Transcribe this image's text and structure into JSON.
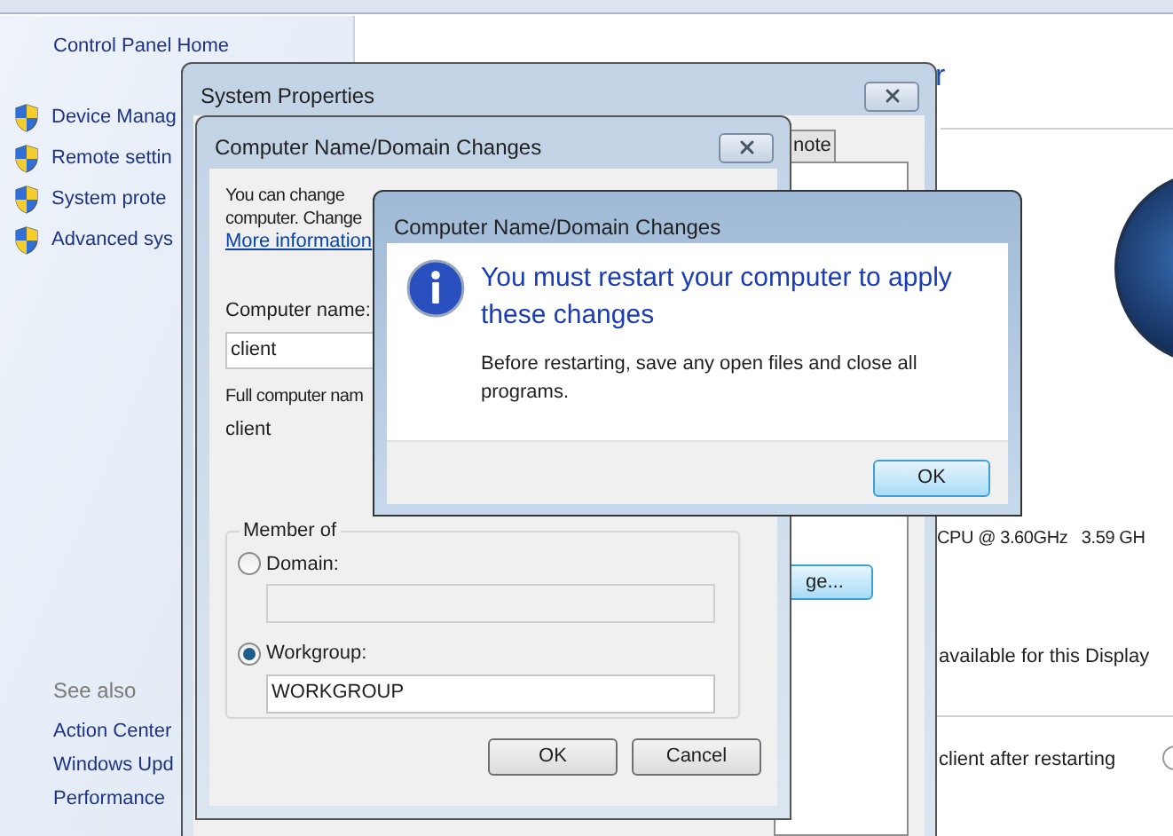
{
  "explorer": {
    "sidebar": {
      "home_link": "Control Panel Home",
      "tasks": [
        "Device Manag",
        "Remote settin",
        "System prote",
        "Advanced sys"
      ],
      "see_also_heading": "See also",
      "see_also": [
        "Action Center",
        "Windows Upd",
        "Performance"
      ]
    },
    "content": {
      "heading": "r",
      "processor": "CPU @ 3.60GHz   3.59 GH",
      "pen_touch": "available for this Display",
      "pending": "client after restarting"
    }
  },
  "system_properties": {
    "title": "System Properties",
    "tabs": [
      {
        "label": "note",
        "selected": false
      }
    ],
    "change_button": "ge..."
  },
  "name_dialog": {
    "title": "Computer Name/Domain Changes",
    "intro_lines": [
      "You can change",
      "computer. Change"
    ],
    "more_info_link": "More information",
    "computer_name_label": "Computer name:",
    "computer_name_value": "client",
    "full_name_label": "Full computer nam",
    "full_name_value": "client",
    "member_of": {
      "legend": "Member of",
      "options": [
        {
          "label": "Domain:",
          "selected": false
        },
        {
          "label": "Workgroup:",
          "selected": true,
          "value": "WORKGROUP"
        }
      ]
    },
    "buttons": [
      "OK",
      "Cancel"
    ]
  },
  "message_box": {
    "title": "Computer Name/Domain Changes",
    "heading": "You must restart your computer to apply these changes",
    "body": "Before restarting, save any open files and close all programs.",
    "button": "OK"
  }
}
